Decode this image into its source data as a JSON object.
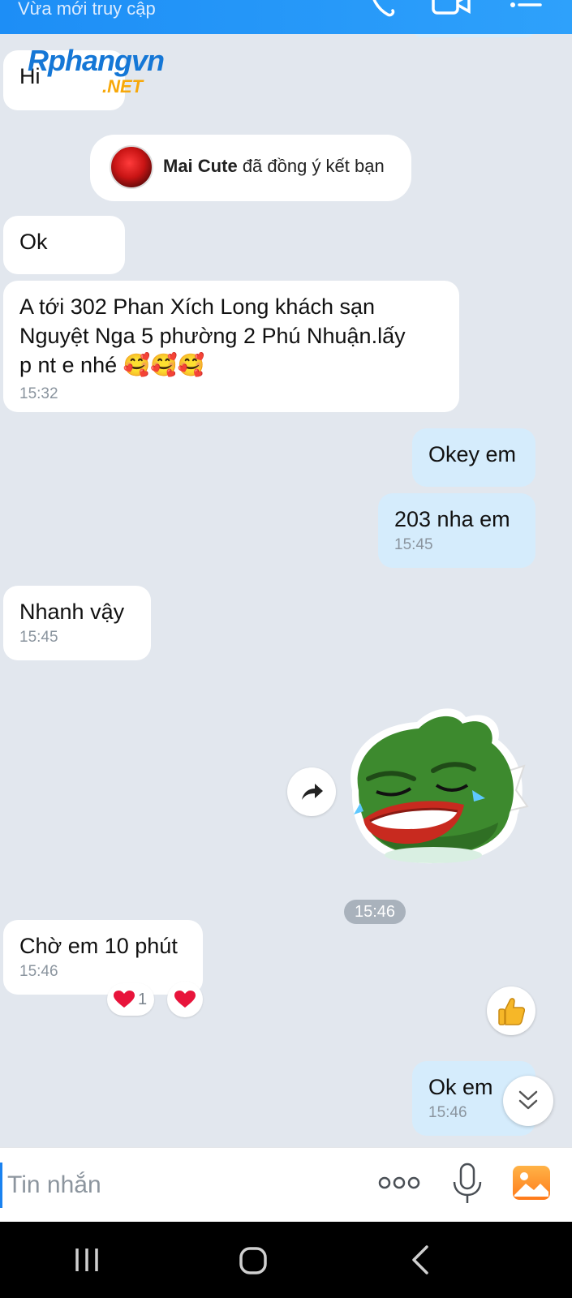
{
  "header": {
    "status": "Vừa mới truy cập"
  },
  "watermark": {
    "brand": "Rphangvn",
    "suffix": ".NET"
  },
  "notice": {
    "name": "Mai Cute",
    "text": "đã đồng ý kết bạn"
  },
  "messages": [
    {
      "side": "in",
      "text": "Hi",
      "time": ""
    },
    {
      "side": "in",
      "text": "Ok",
      "time": ""
    },
    {
      "side": "in",
      "text_lines": [
        "A tới 302 Phan Xích Long khách sạn",
        "Nguyệt Nga 5 phường 2 Phú Nhuận.lấy",
        "p nt e nhé 🥰🥰🥰"
      ],
      "time": "15:32"
    },
    {
      "side": "out",
      "text": "Okey em",
      "time": ""
    },
    {
      "side": "out",
      "text": "203 nha em",
      "time": "15:45"
    },
    {
      "side": "in",
      "text": "Nhanh vậy",
      "time": "15:45"
    },
    {
      "side": "out",
      "type": "sticker",
      "sticker": "laughing-frog",
      "time": "15:46"
    },
    {
      "side": "in",
      "text": "Chờ em 10 phút",
      "time": "15:46",
      "reactions": {
        "heart_count": "1"
      }
    },
    {
      "side": "out",
      "text": "Ok em",
      "time": "15:46"
    }
  ],
  "input": {
    "placeholder": "Tin nhắn"
  },
  "icons": [
    "phone-icon",
    "video-icon",
    "menu-icon",
    "share-icon",
    "thumbs-up-icon",
    "scroll-down-icon",
    "more-icon",
    "mic-icon",
    "image-icon",
    "recent-apps-icon",
    "home-icon",
    "back-icon"
  ],
  "colors": {
    "header": "#1d8ef6",
    "outgoing_bubble": "#d5ecfc",
    "incoming_bubble": "#ffffff",
    "background": "#e2e7ee",
    "heart": "#e8143b"
  }
}
